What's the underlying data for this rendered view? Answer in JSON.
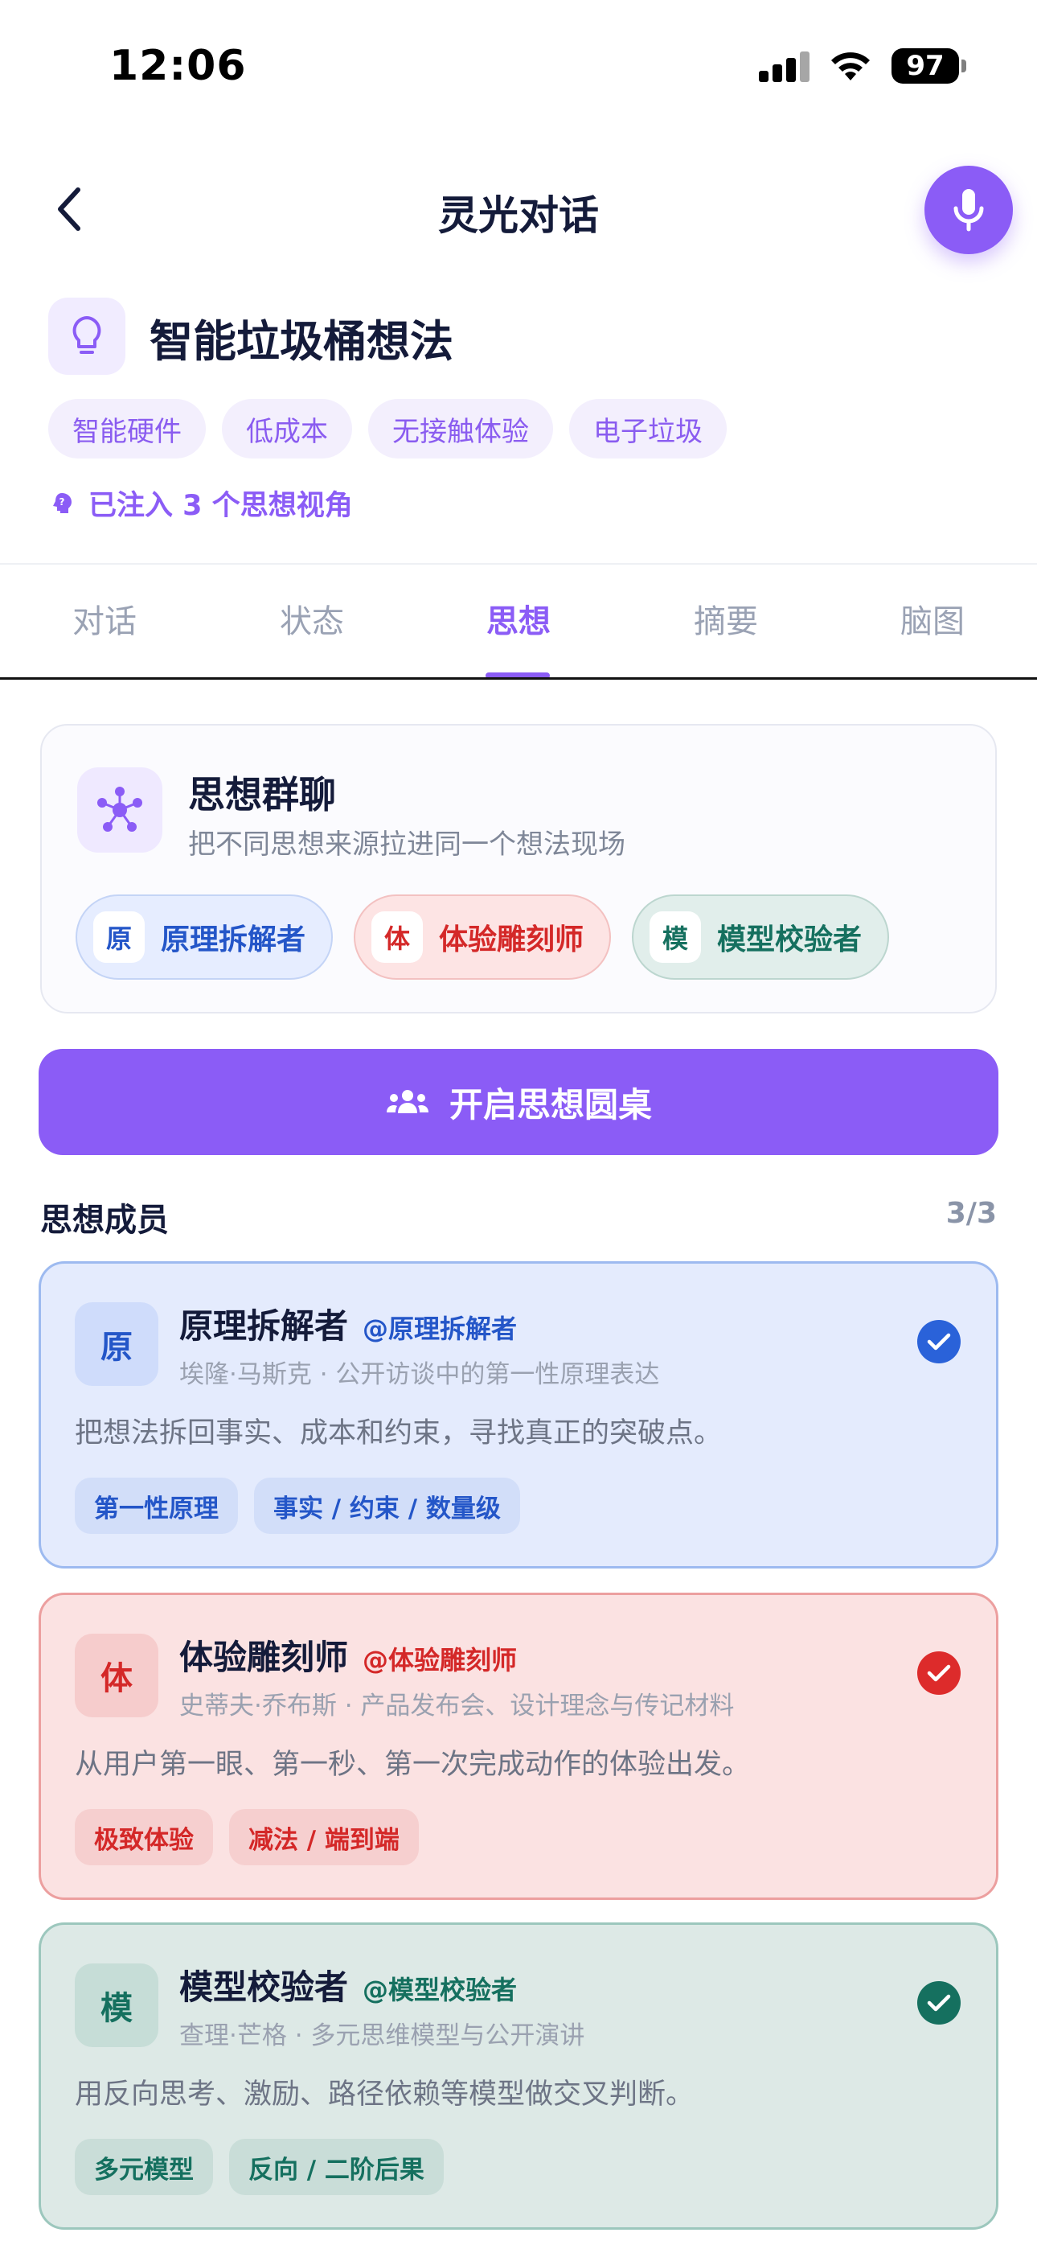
{
  "status_bar": {
    "time": "12:06",
    "battery": "97"
  },
  "nav": {
    "title": "灵光对话",
    "back_icon": "chevron-left-icon",
    "mic_icon": "microphone-icon"
  },
  "idea": {
    "title": "智能垃圾桶想法",
    "icon": "lightbulb-icon",
    "tags": [
      "智能硬件",
      "低成本",
      "无接触体验",
      "电子垃圾"
    ],
    "injected_text": "已注入 3 个思想视角"
  },
  "tabs": [
    {
      "label": "对话",
      "active": false
    },
    {
      "label": "状态",
      "active": false
    },
    {
      "label": "思想",
      "active": true
    },
    {
      "label": "摘要",
      "active": false
    },
    {
      "label": "脑图",
      "active": false
    }
  ],
  "group_chat": {
    "title": "思想群聊",
    "subtitle": "把不同思想来源拉进同一个想法现场",
    "chips": [
      {
        "letter": "原",
        "label": "原理拆解者"
      },
      {
        "letter": "体",
        "label": "体验雕刻师"
      },
      {
        "letter": "模",
        "label": "模型校验者"
      }
    ]
  },
  "cta": {
    "label": "开启思想圆桌",
    "icon": "users-icon"
  },
  "members_section": {
    "title": "思想成员",
    "count": "3/3"
  },
  "members": [
    {
      "letter": "原",
      "name": "原理拆解者",
      "handle": "@原理拆解者",
      "source": "埃隆·马斯克 · 公开访谈中的第一性原理表达",
      "description": "把想法拆回事实、成本和约束，寻找真正的突破点。",
      "tags": [
        "第一性原理",
        "事实 / 约束 / 数量级"
      ],
      "selected": true,
      "color": "#2a62d9"
    },
    {
      "letter": "体",
      "name": "体验雕刻师",
      "handle": "@体验雕刻师",
      "source": "史蒂夫·乔布斯 · 产品发布会、设计理念与传记材料",
      "description": "从用户第一眼、第一秒、第一次完成动作的体验出发。",
      "tags": [
        "极致体验",
        "减法 / 端到端"
      ],
      "selected": true,
      "color": "#dd2b2b"
    },
    {
      "letter": "模",
      "name": "模型校验者",
      "handle": "@模型校验者",
      "source": "查理·芒格 · 多元思维模型与公开演讲",
      "description": "用反向思考、激励、路径依赖等模型做交叉判断。",
      "tags": [
        "多元模型",
        "反向 / 二阶后果"
      ],
      "selected": true,
      "color": "#15705f"
    }
  ],
  "accent": "#8b5cf6"
}
